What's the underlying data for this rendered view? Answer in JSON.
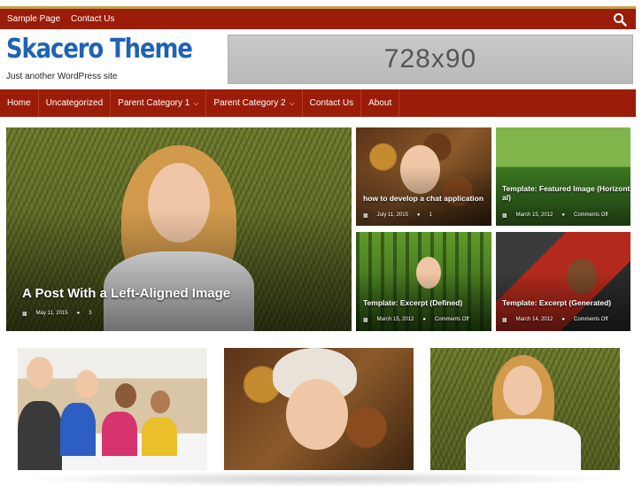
{
  "topbar": {
    "links": [
      "Sample Page",
      "Contact Us"
    ],
    "search_icon": "search-icon",
    "bg": "#9b1c08"
  },
  "header": {
    "site_title": "Skacero Theme",
    "tagline": "Just another WordPress site",
    "ad_text": "728x90",
    "title_color": "#1f63b3"
  },
  "nav": {
    "items": [
      {
        "label": "Home",
        "dropdown": false
      },
      {
        "label": "Uncategorized",
        "dropdown": false
      },
      {
        "label": "Parent Category 1",
        "dropdown": true
      },
      {
        "label": "Parent Category 2",
        "dropdown": true
      },
      {
        "label": "Contact Us",
        "dropdown": false
      },
      {
        "label": "About",
        "dropdown": false
      }
    ]
  },
  "featured": {
    "main": {
      "title": "A Post With a Left-Aligned Image",
      "date": "May 11, 2015",
      "comments": "3"
    },
    "grid": [
      {
        "title": "how to develop a chat application",
        "date": "July 11, 2015",
        "comments": "1"
      },
      {
        "title": "Template: Featured Image (Horizont al)",
        "date": "March 15, 2012",
        "comments": "Comments Off"
      },
      {
        "title": "Template: Excerpt (Defined)",
        "date": "March 15, 2012",
        "comments": "Comments Off"
      },
      {
        "title": "Template: Excerpt (Generated)",
        "date": "March 14, 2012",
        "comments": "Comments Off"
      }
    ]
  },
  "bottom_images": [
    "classroom-students",
    "child-in-leaves",
    "woman-in-grass"
  ]
}
